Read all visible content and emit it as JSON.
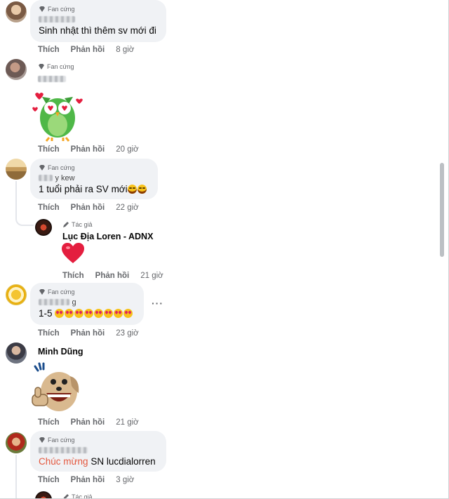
{
  "badges": {
    "fan": "Fan cứng",
    "author": "Tác giả"
  },
  "actions": {
    "like": "Thích",
    "reply": "Phản hồi"
  },
  "comments": [
    {
      "text": "Sinh nhật thì thêm sv mới đi",
      "time": "8 giờ"
    },
    {
      "time": "20 giờ"
    },
    {
      "name_visible_part": "y kew",
      "text": "1 tuổi phải ra SV mới",
      "time": "22 giờ"
    },
    {
      "name": "Lục Địa Loren - ADNX",
      "time": "21 giờ"
    },
    {
      "name_visible_part": "g",
      "text": "1-5",
      "time": "23 giờ"
    },
    {
      "name": "Minh Dũng",
      "time": "21 giờ"
    },
    {
      "text_highlight": "Chúc mừng",
      "text": "SN lucdialorren",
      "time": "3 giờ"
    }
  ],
  "colors": {
    "bubble": "#f0f2f5",
    "meta": "#65676b",
    "highlight": "#e4573d",
    "heart": "#e41e3f"
  },
  "icons": [
    "gem-icon",
    "pencil-icon",
    "more-options-icon",
    "heart-icon",
    "owl-sticker",
    "dog-sticker"
  ]
}
